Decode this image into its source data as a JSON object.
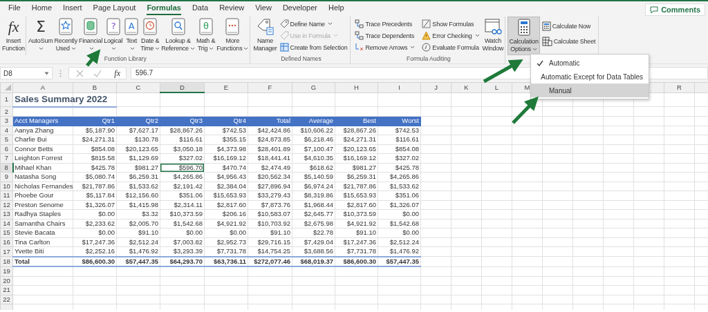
{
  "tabs": [
    {
      "label": "File",
      "selected": false
    },
    {
      "label": "Home",
      "selected": false
    },
    {
      "label": "Insert",
      "selected": false
    },
    {
      "label": "Page Layout",
      "selected": false
    },
    {
      "label": "Formulas",
      "selected": true
    },
    {
      "label": "Data",
      "selected": false
    },
    {
      "label": "Review",
      "selected": false
    },
    {
      "label": "View",
      "selected": false
    },
    {
      "label": "Developer",
      "selected": false
    },
    {
      "label": "Help",
      "selected": false
    }
  ],
  "comments_button": "Comments",
  "function_library": {
    "label": "Function Library",
    "buttons": [
      {
        "lines": [
          "Insert",
          "Function"
        ],
        "glyph": "fx",
        "dropdown": false
      },
      {
        "lines": [
          "AutoSum"
        ],
        "glyph": "Σ",
        "dropdown": true
      },
      {
        "lines": [
          "Recently",
          "Used"
        ],
        "dropdown": true
      },
      {
        "lines": [
          "Financial"
        ],
        "dropdown": true
      },
      {
        "lines": [
          "Logical"
        ],
        "glyph": "?",
        "dropdown": true
      },
      {
        "lines": [
          "Text"
        ],
        "glyph": "A",
        "dropdown": true
      },
      {
        "lines": [
          "Date &",
          "Time"
        ],
        "dropdown": true
      },
      {
        "lines": [
          "Lookup &",
          "Reference"
        ],
        "dropdown": true
      },
      {
        "lines": [
          "Math &",
          "Trig"
        ],
        "glyph": "θ",
        "dropdown": true
      },
      {
        "lines": [
          "More",
          "Functions"
        ],
        "dropdown": true
      }
    ]
  },
  "defined_names": {
    "label": "Defined Names",
    "large": {
      "lines": [
        "Name",
        "Manager"
      ]
    },
    "small": [
      {
        "label": "Define Name",
        "dropdown": true,
        "disabled": false
      },
      {
        "label": "Use in Formula",
        "dropdown": true,
        "disabled": true
      },
      {
        "label": "Create from Selection",
        "dropdown": false,
        "disabled": false
      }
    ]
  },
  "formula_auditing": {
    "label": "Formula Auditing",
    "small": [
      {
        "label": "Trace Precedents",
        "dropdown": false
      },
      {
        "label": "Trace Dependents",
        "dropdown": false
      },
      {
        "label": "Remove Arrows",
        "dropdown": true
      },
      {
        "label": "Show Formulas",
        "dropdown": false
      },
      {
        "label": "Error Checking",
        "dropdown": true
      },
      {
        "label": "Evaluate Formula",
        "dropdown": false
      }
    ],
    "large": {
      "lines": [
        "Watch",
        "Window"
      ]
    }
  },
  "calculation": {
    "large": {
      "lines": [
        "Calculation",
        "Options"
      ],
      "dropdown": true,
      "pressed": true
    },
    "small": [
      {
        "label": "Calculate Now"
      },
      {
        "label": "Calculate Sheet"
      }
    ]
  },
  "formula_bar": {
    "name_box": "D8",
    "fx": "fx",
    "value": "596.7"
  },
  "sheet": {
    "columns": [
      {
        "label": "A",
        "selected": false
      },
      {
        "label": "B",
        "selected": false
      },
      {
        "label": "C",
        "selected": false
      },
      {
        "label": "D",
        "selected": true
      },
      {
        "label": "E",
        "selected": false
      },
      {
        "label": "F",
        "selected": false
      },
      {
        "label": "G",
        "selected": false
      },
      {
        "label": "H",
        "selected": false
      },
      {
        "label": "I",
        "selected": false
      },
      {
        "label": "J",
        "selected": false
      },
      {
        "label": "K",
        "selected": false
      },
      {
        "label": "L",
        "selected": false
      },
      {
        "label": "M",
        "selected": false
      }
    ],
    "far_columns": [
      "R"
    ],
    "rows": [
      {
        "number": "1",
        "kind": "title",
        "selected": false,
        "cells": [
          "Sales Summary 2022"
        ]
      },
      {
        "number": "2",
        "kind": "blank",
        "selected": false
      },
      {
        "number": "3",
        "kind": "header",
        "selected": false,
        "cells": [
          "Acct Managers",
          "Qtr1",
          "Qtr2",
          "Qtr3",
          "Qtr4",
          "Total",
          "Average",
          "Best",
          "Worst"
        ]
      },
      {
        "number": "4",
        "kind": "data",
        "selected": false,
        "cells": [
          "Aanya Zhang",
          "$5,187.90",
          "$7,627.17",
          "$28,867.26",
          "$742.53",
          "$42,424.86",
          "$10,606.22",
          "$28,867.26",
          "$742.53"
        ]
      },
      {
        "number": "5",
        "kind": "data",
        "selected": false,
        "cells": [
          "Charlie Bui",
          "$24,271.31",
          "$130.78",
          "$116.61",
          "$355.15",
          "$24,873.85",
          "$6,218.46",
          "$24,271.31",
          "$116.61"
        ]
      },
      {
        "number": "6",
        "kind": "data",
        "selected": false,
        "cells": [
          "Connor Betts",
          "$854.08",
          "$20,123.65",
          "$3,050.18",
          "$4,373.98",
          "$28,401.89",
          "$7,100.47",
          "$20,123.65",
          "$854.08"
        ]
      },
      {
        "number": "7",
        "kind": "data",
        "selected": false,
        "cells": [
          "Leighton Forrest",
          "$815.58",
          "$1,129.69",
          "$327.02",
          "$16,169.12",
          "$18,441.41",
          "$4,610.35",
          "$16,169.12",
          "$327.02"
        ]
      },
      {
        "number": "8",
        "kind": "data",
        "selected": true,
        "cells": [
          "Mihael Khan",
          "$425.78",
          "$981.27",
          "$596.70",
          "$470.74",
          "$2,474.49",
          "$618.62",
          "$981.27",
          "$425.78"
        ]
      },
      {
        "number": "9",
        "kind": "data",
        "selected": false,
        "cells": [
          "Natasha Song",
          "$5,080.74",
          "$6,259.31",
          "$4,265.86",
          "$4,956.43",
          "$20,562.34",
          "$5,140.59",
          "$6,259.31",
          "$4,265.86"
        ]
      },
      {
        "number": "10",
        "kind": "data",
        "selected": false,
        "cells": [
          "Nicholas Fernandes",
          "$21,787.86",
          "$1,533.62",
          "$2,191.42",
          "$2,384.04",
          "$27,896.94",
          "$6,974.24",
          "$21,787.86",
          "$1,533.62"
        ]
      },
      {
        "number": "11",
        "kind": "data",
        "selected": false,
        "cells": [
          "Phoebe Gour",
          "$5,117.84",
          "$12,156.60",
          "$351.06",
          "$15,653.93",
          "$33,279.43",
          "$8,319.86",
          "$15,653.93",
          "$351.06"
        ]
      },
      {
        "number": "12",
        "kind": "data",
        "selected": false,
        "cells": [
          "Preston Senome",
          "$1,326.07",
          "$1,415.98",
          "$2,314.11",
          "$2,817.60",
          "$7,873.76",
          "$1,968.44",
          "$2,817.60",
          "$1,326.07"
        ]
      },
      {
        "number": "13",
        "kind": "data",
        "selected": false,
        "cells": [
          "Radhya Staples",
          "$0.00",
          "$3.32",
          "$10,373.59",
          "$206.16",
          "$10,583.07",
          "$2,645.77",
          "$10,373.59",
          "$0.00"
        ]
      },
      {
        "number": "14",
        "kind": "data",
        "selected": false,
        "cells": [
          "Samantha Chairs",
          "$2,233.62",
          "$2,005.70",
          "$1,542.68",
          "$4,921.92",
          "$10,703.92",
          "$2,675.98",
          "$4,921.92",
          "$1,542.68"
        ]
      },
      {
        "number": "15",
        "kind": "data",
        "selected": false,
        "cells": [
          "Stevie Bacata",
          "$0.00",
          "$91.10",
          "$0.00",
          "$0.00",
          "$91.10",
          "$22.78",
          "$91.10",
          "$0.00"
        ]
      },
      {
        "number": "16",
        "kind": "data",
        "selected": false,
        "cells": [
          "Tina Carlton",
          "$17,247.36",
          "$2,512.24",
          "$7,003.82",
          "$2,952.73",
          "$29,716.15",
          "$7,429.04",
          "$17,247.36",
          "$2,512.24"
        ]
      },
      {
        "number": "17",
        "kind": "data",
        "selected": false,
        "cells": [
          "Yvette Biti",
          "$2,252.16",
          "$1,476.92",
          "$3,293.39",
          "$7,731.78",
          "$14,754.25",
          "$3,688.56",
          "$7,731.78",
          "$1,476.92"
        ]
      },
      {
        "number": "18",
        "kind": "total",
        "selected": false,
        "cells": [
          "Total",
          "$86,600.30",
          "$57,447.35",
          "$64,293.70",
          "$63,736.11",
          "$272,077.46",
          "$68,019.37",
          "$86,600.30",
          "$57,447.35"
        ]
      },
      {
        "number": "19",
        "kind": "blank",
        "selected": false
      },
      {
        "number": "20",
        "kind": "blank",
        "selected": false
      },
      {
        "number": "21",
        "kind": "blank",
        "selected": false
      },
      {
        "number": "22",
        "kind": "blank",
        "selected": false
      }
    ]
  },
  "calc_menu": {
    "items": [
      {
        "label": "Automatic",
        "checked": true,
        "selected": false
      },
      {
        "label": "Automatic Except for Data Tables",
        "checked": false,
        "selected": false
      },
      {
        "label": "Manual",
        "checked": false,
        "selected": true
      }
    ]
  }
}
